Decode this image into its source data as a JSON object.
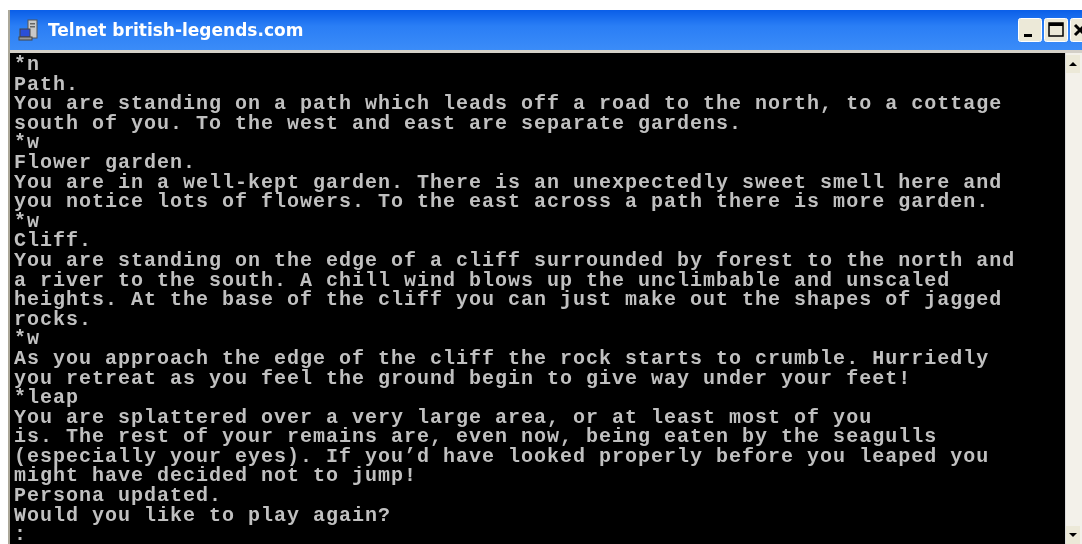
{
  "window": {
    "title": "Telnet british-legends.com"
  },
  "terminal": {
    "lines": [
      "*n",
      "Path.",
      "You are standing on a path which leads off a road to the north, to a cottage",
      "south of you. To the west and east are separate gardens.",
      "*w",
      "Flower garden.",
      "You are in a well-kept garden. There is an unexpectedly sweet smell here and",
      "you notice lots of flowers. To the east across a path there is more garden.",
      "*w",
      "Cliff.",
      "You are standing on the edge of a cliff surrounded by forest to the north and",
      "a river to the south. A chill wind blows up the unclimbable and unscaled",
      "heights. At the base of the cliff you can just make out the shapes of jagged",
      "rocks.",
      "*w",
      "As you approach the edge of the cliff the rock starts to crumble. Hurriedly",
      "you retreat as you feel the ground begin to give way under your feet!",
      "*leap",
      "You are splattered over a very large area, or at least most of you",
      "is. The rest of your remains are, even now, being eaten by the seagulls",
      "(especially your eyes). If you’d have looked properly before you leaped you",
      "might have decided not to jump!",
      "Persona updated.",
      "Would you like to play again?",
      ":"
    ]
  }
}
